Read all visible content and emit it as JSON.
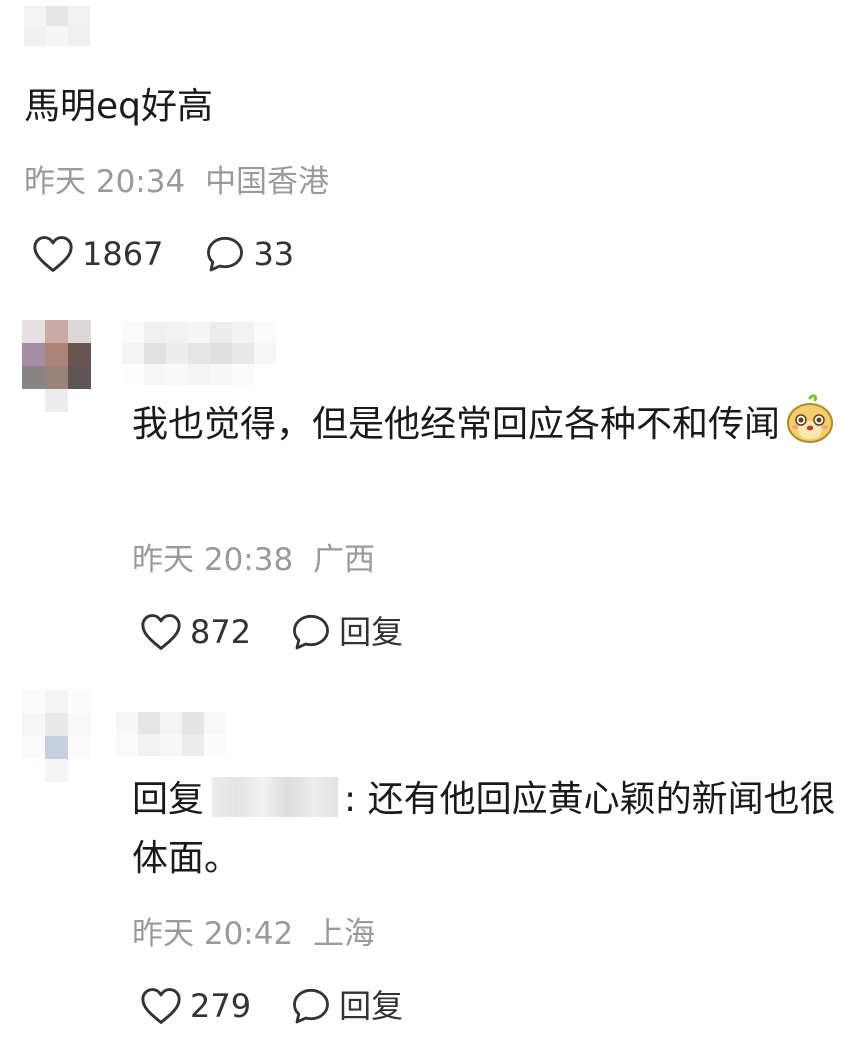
{
  "comment": {
    "text": "馬明eq好高",
    "time": "昨天 20:34",
    "location": "中国香港",
    "likes": "1867",
    "replies": "33"
  },
  "replies": [
    {
      "text": "我也觉得，但是他经常回应各种不和传闻",
      "emoji": "mole-emoji",
      "time": "昨天 20:38",
      "location": "广西",
      "likes": "872",
      "reply_label": "回复"
    },
    {
      "prefix": "回复",
      "text": ": 还有他回应黄心颖的新闻也很体面。",
      "time": "昨天 20:42",
      "location": "上海",
      "likes": "279",
      "reply_label": "回复"
    }
  ],
  "icons": [
    "heart-icon",
    "comment-bubble-icon"
  ],
  "colors": {
    "meta": "#9a9a9a",
    "text": "#1a1a1a"
  }
}
